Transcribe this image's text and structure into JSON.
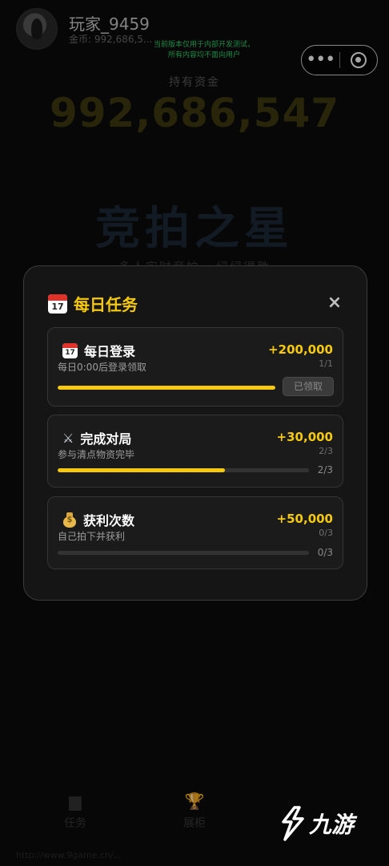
{
  "player": {
    "name": "玩家_9459",
    "gold_label": "金币: 992,686,5..."
  },
  "notice": {
    "line1": "当前版本仅用于内部开发测试，",
    "line2": "所有内容均不面向用户"
  },
  "capsule": {
    "more_icon": "more-dots-icon",
    "close_icon": "target-icon"
  },
  "funds": {
    "label": "持有资金",
    "value": "992,686,547"
  },
  "game": {
    "title": "竞拍之星",
    "subtitle": "多人实时竞拍 · 绿绿得胜"
  },
  "modal": {
    "title": "每日任务",
    "close_label": "×",
    "tasks": [
      {
        "icon": "calendar-icon",
        "name": "每日登录",
        "desc": "每日0:00后登录领取",
        "reward": "+200,000",
        "count": "1/1",
        "progress": 1.0,
        "action": "已领取"
      },
      {
        "icon": "crossed-swords-icon",
        "name": "完成对局",
        "desc": "参与清点物资完毕",
        "reward": "+30,000",
        "count": "2/3",
        "progress": 0.667,
        "progress_text": "2/3"
      },
      {
        "icon": "money-bag-icon",
        "name": "获利次数",
        "desc": "自己拍下并获利",
        "reward": "+50,000",
        "count": "0/3",
        "progress": 0.0,
        "progress_text": "0/3"
      }
    ]
  },
  "nav": {
    "items": [
      {
        "label": "任务"
      },
      {
        "label": "展柜"
      }
    ]
  },
  "watermark": {
    "text": "九游"
  },
  "footer": {
    "url": "http://www.9game.cn/..."
  },
  "colors": {
    "accent": "#f6c90e",
    "background": "#000000",
    "notice": "#2fd36a"
  }
}
